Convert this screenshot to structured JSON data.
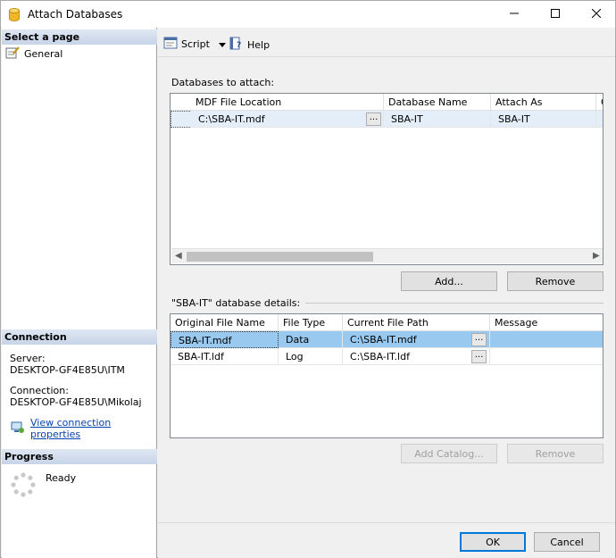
{
  "window": {
    "title": "Attach Databases"
  },
  "left": {
    "select_page": "Select a page",
    "pages": [
      {
        "label": "General"
      }
    ],
    "connection_head": "Connection",
    "server_label": "Server:",
    "server_value": "DESKTOP-GF4E85U\\ITM",
    "connection_label": "Connection:",
    "connection_value": "DESKTOP-GF4E85U\\Mikolaj",
    "view_props": "View connection properties",
    "progress_head": "Progress",
    "progress_status": "Ready"
  },
  "toolbar": {
    "script": "Script",
    "help": "Help"
  },
  "attach": {
    "label": "Databases to attach:",
    "columns": [
      "MDF File Location",
      "Database Name",
      "Attach As",
      "O"
    ],
    "rows": [
      {
        "mdf": "C:\\SBA-IT.mdf",
        "db_name": "SBA-IT",
        "attach_as": "SBA-IT"
      }
    ],
    "add": "Add...",
    "remove": "Remove"
  },
  "details": {
    "label": "\"SBA-IT\" database details:",
    "columns": [
      "Original File Name",
      "File Type",
      "Current File Path",
      "Message"
    ],
    "rows": [
      {
        "orig": "SBA-IT.mdf",
        "type": "Data",
        "path": "C:\\SBA-IT.mdf",
        "msg": ""
      },
      {
        "orig": "SBA-IT.ldf",
        "type": "Log",
        "path": "C:\\SBA-IT.ldf",
        "msg": ""
      }
    ],
    "add_catalog": "Add Catalog...",
    "remove": "Remove"
  },
  "footer": {
    "ok": "OK",
    "cancel": "Cancel"
  },
  "colors": {
    "selection": "#99c9ef",
    "header_gradient": "#c7d4e8",
    "link": "#0645ad"
  },
  "icons": [
    "database-icon",
    "minimize-icon",
    "maximize-icon",
    "close-icon",
    "general-page-icon",
    "script-icon",
    "dropdown-arrow-icon",
    "help-icon",
    "connection-properties-icon",
    "progress-spinner-icon"
  ]
}
